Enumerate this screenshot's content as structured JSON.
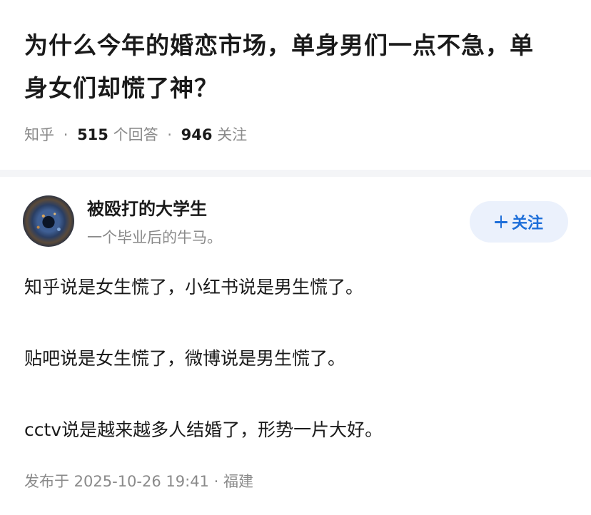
{
  "question": {
    "title": "为什么今年的婚恋市场，单身男们一点不急，单身女们却慌了神？",
    "source": "知乎",
    "answer_count": "515",
    "answer_label": "个回答",
    "follower_count": "946",
    "follower_label": "关注",
    "separator": "·"
  },
  "answer": {
    "author": {
      "name": "被殴打的大学生",
      "bio": "一个毕业后的牛马。",
      "avatar_icon": "galaxy-avatar"
    },
    "follow_button": {
      "label": "关注",
      "icon": "plus-icon",
      "color": "#1e6fd9",
      "background": "#ebf1fc"
    },
    "paragraphs": [
      "知乎说是女生慌了，小红书说是男生慌了。",
      "贴吧说是女生慌了，微博说是男生慌了。",
      "cctv说是越来越多人结婚了，形势一片大好。"
    ],
    "published": "发布于 2025-10-26 19:41",
    "location": "福建",
    "separator": "·"
  }
}
